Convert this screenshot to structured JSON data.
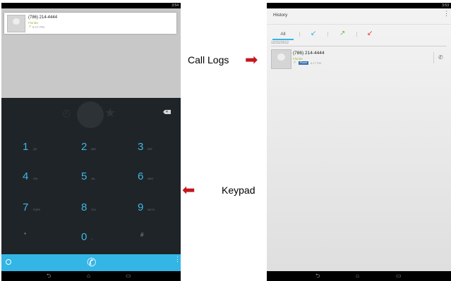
{
  "left_phone": {
    "status": {
      "time": "3:54"
    },
    "recent_card": {
      "number": "(786) 214-4444",
      "location": "Florida",
      "time": "6:17 PM"
    },
    "keypad": {
      "backspace_label": "✕",
      "keys": [
        {
          "digit": "1",
          "letters": "QD"
        },
        {
          "digit": "2",
          "letters": "ABC"
        },
        {
          "digit": "3",
          "letters": "DEF"
        },
        {
          "digit": "4",
          "letters": "GHI"
        },
        {
          "digit": "5",
          "letters": "JKL"
        },
        {
          "digit": "6",
          "letters": "MNO"
        },
        {
          "digit": "7",
          "letters": "PQRS"
        },
        {
          "digit": "8",
          "letters": "TUV"
        },
        {
          "digit": "9",
          "letters": "WXYZ"
        },
        {
          "digit": "*",
          "letters": ""
        },
        {
          "digit": "0",
          "letters": "+"
        },
        {
          "digit": "#",
          "letters": ""
        }
      ]
    },
    "icons": {
      "dial": "phone-icon",
      "clock": "clock-icon",
      "menu": "overflow-menu-icon",
      "nav": [
        "back-icon",
        "home-icon",
        "recents-icon"
      ]
    },
    "colors": {
      "dial_bar": "#33b5e5",
      "digit": "#3fb7e4",
      "keypad_bg": "#1f2428"
    }
  },
  "right_phone": {
    "status": {
      "time": "3:53"
    },
    "header": {
      "title": "History"
    },
    "tabs": [
      {
        "label": "All",
        "selected": true
      },
      {
        "icon": "incoming-call-icon",
        "color": "#33b5e5"
      },
      {
        "icon": "outgoing-call-icon",
        "color": "#6cc04a"
      },
      {
        "icon": "missed-call-icon",
        "color": "#e53935"
      }
    ],
    "date": "12/31/2012",
    "log_entry": {
      "number": "(786) 214-4444",
      "location": "Florida",
      "badge": "Phone",
      "time": "6:17 PM"
    }
  },
  "annotations": {
    "call_logs": "Call Logs",
    "keypad": "Keypad",
    "arrow_color": "#c4161c"
  }
}
